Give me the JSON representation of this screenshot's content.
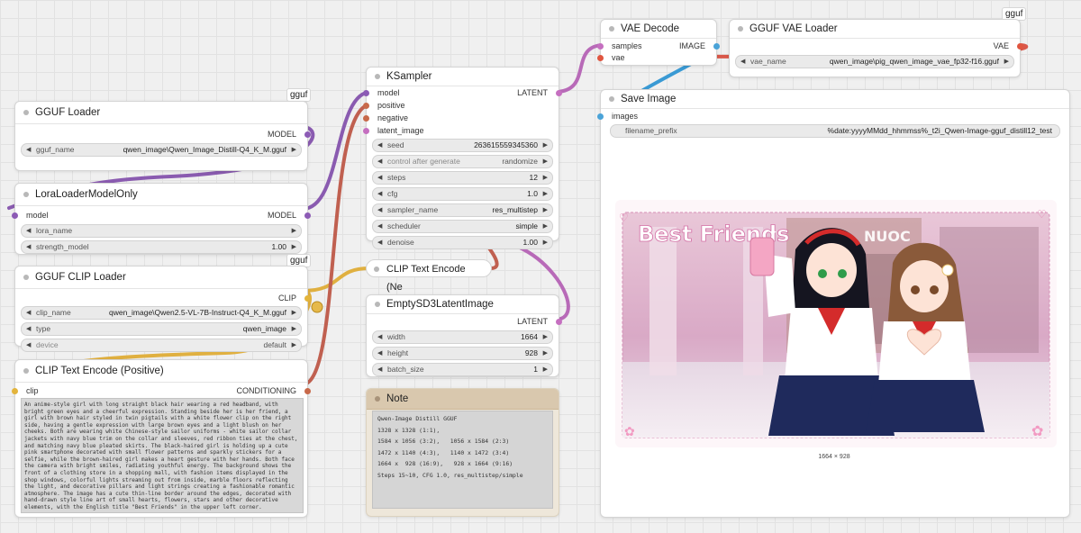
{
  "colors": {
    "model": "#8c5bb5",
    "clip": "#e3b43c",
    "conditioning": "#c8694a",
    "latent": "#c56fc0",
    "vae": "#e0553f",
    "image": "#4aa3d8",
    "wire_model": "#8a5bb0",
    "wire_clip": "#e0b040",
    "wire_cond": "#c06050",
    "wire_latent": "#b86ab8",
    "wire_vae": "#d9584a",
    "wire_image": "#3a9ad4"
  },
  "gguf_loader": {
    "badge": "gguf",
    "title": "GGUF Loader",
    "out_model": "MODEL",
    "w_label": "gguf_name",
    "w_value": "qwen_image\\Qwen_Image_Distill-Q4_K_M.gguf"
  },
  "lora": {
    "title": "LoraLoaderModelOnly",
    "in_model": "model",
    "out_model": "MODEL",
    "w1_label": "lora_name",
    "w2_label": "strength_model",
    "w2_value": "1.00"
  },
  "clip_loader": {
    "badge": "gguf",
    "title": "GGUF CLIP Loader",
    "out_clip": "CLIP",
    "w1_label": "clip_name",
    "w1_value": "qwen_image\\Qwen2.5-VL-7B-Instruct-Q4_K_M.gguf",
    "w2_label": "type",
    "w2_value": "qwen_image",
    "w3_label": "device",
    "w3_value": "default"
  },
  "clip_pos": {
    "title": "CLIP Text Encode (Positive)",
    "in_clip": "clip",
    "out_cond": "CONDITIONING",
    "text": "An anime-style girl with long straight black hair wearing a red headband, with bright green eyes and a cheerful expression. Standing beside her is her friend, a girl with brown hair styled in twin pigtails with a white flower clip on the right side, having a gentle expression with large brown eyes and a light blush on her cheeks. Both are wearing white Chinese-style sailor uniforms - white sailor collar jackets with navy blue trim on the collar and sleeves, red ribbon ties at the chest, and matching navy blue pleated skirts. The black-haired girl is holding up a cute pink smartphone decorated with small flower patterns and sparkly stickers for a selfie, while the brown-haired girl makes a heart gesture with her hands. Both face the camera with bright smiles, radiating youthful energy. The background shows the front of a clothing store in a shopping mall, with fashion items displayed in the shop windows, colorful lights streaming out from inside, marble floors reflecting the light, and decorative pillars and light strings creating a fashionable romantic atmosphere. The image has a cute thin-line border around the edges, decorated with hand-drawn style line art of small hearts, flowers, stars and other decorative elements, with the English title \"Best Friends\" in the upper left corner."
  },
  "ksampler": {
    "title": "KSampler",
    "in_model": "model",
    "in_positive": "positive",
    "in_negative": "negative",
    "in_latent": "latent_image",
    "out_latent": "LATENT",
    "widgets": [
      {
        "label": "seed",
        "value": "263615559345360"
      },
      {
        "label": "control after generate",
        "value": "randomize"
      },
      {
        "label": "steps",
        "value": "12"
      },
      {
        "label": "cfg",
        "value": "1.0"
      },
      {
        "label": "sampler_name",
        "value": "res_multistep"
      },
      {
        "label": "scheduler",
        "value": "simple"
      },
      {
        "label": "denoise",
        "value": "1.00"
      }
    ]
  },
  "clip_neg": {
    "title": "CLIP Text Encode (Ne"
  },
  "latent": {
    "title": "EmptySD3LatentImage",
    "out_latent": "LATENT",
    "widgets": [
      {
        "label": "width",
        "value": "1664"
      },
      {
        "label": "height",
        "value": "928"
      },
      {
        "label": "batch_size",
        "value": "1"
      }
    ]
  },
  "note": {
    "title": "Note",
    "lines": [
      "Qwen-Image Distill GGUF",
      "1328 x 1328 (1:1),",
      "1584 x 1056 (3:2),   1056 x 1584 (2:3)",
      "1472 x 1140 (4:3),   1140 x 1472 (3:4)",
      "1664 x  928 (16:9),   928 x 1664 (9:16)",
      "Steps 15~10, CFG 1.0, res_multistep/simple"
    ]
  },
  "vae_decode": {
    "title": "VAE Decode",
    "in_samples": "samples",
    "in_vae": "vae",
    "out_image": "IMAGE"
  },
  "vae_loader": {
    "badge": "gguf",
    "title": "GGUF VAE Loader",
    "out_vae": "VAE",
    "w_label": "vae_name",
    "w_value": "qwen_image\\pig_qwen_image_vae_fp32-f16.gguf"
  },
  "save_image": {
    "title": "Save Image",
    "in_images": "images",
    "w_label": "filename_prefix",
    "w_value": "%date:yyyyMMdd_hhmmss%_t2i_Qwen-Image-gguf_distill12_test",
    "caption": "1664 × 928",
    "image_title": "Best Friends",
    "store_sign": "NUOC"
  }
}
